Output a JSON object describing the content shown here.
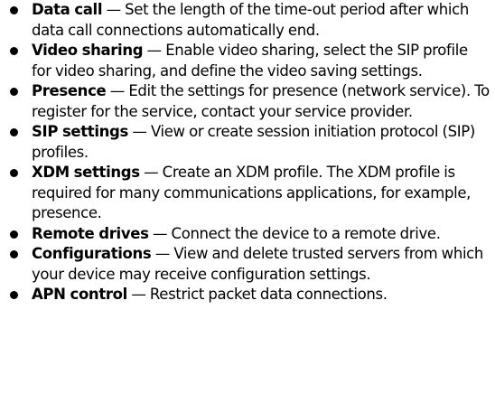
{
  "settings_list": {
    "items": [
      {
        "term": "Data call",
        "separator": " — ",
        "description": "Set the length of the time-out period after which data call connections automatically end."
      },
      {
        "term": "Video sharing",
        "separator": " — ",
        "description": "Enable video sharing, select the SIP profile for video sharing, and define the video saving settings."
      },
      {
        "term": "Presence",
        "separator": " — ",
        "description": "Edit the settings for presence (network service). To register for the service, contact your service provider."
      },
      {
        "term": "SIP settings",
        "separator": " — ",
        "description": "View or create session initiation protocol (SIP) profiles."
      },
      {
        "term": "XDM settings",
        "separator": " — ",
        "description": "Create an XDM profile. The XDM profile is required for many communications applications, for example, presence."
      },
      {
        "term": "Remote drives",
        "separator": " — ",
        "description": "Connect the device to a remote drive."
      },
      {
        "term": "Configurations",
        "separator": " — ",
        "description": "View and delete trusted servers from which your device may receive configuration settings."
      },
      {
        "term": "APN control",
        "separator": " — ",
        "description": "Restrict packet data connections."
      }
    ]
  }
}
